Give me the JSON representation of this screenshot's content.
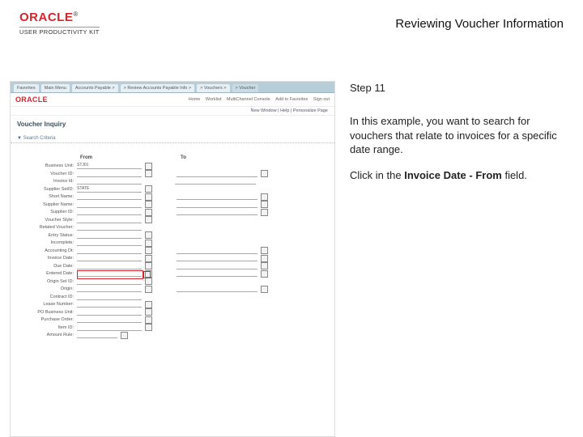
{
  "header": {
    "brand": "ORACLE",
    "tm": "®",
    "sub": "USER PRODUCTIVITY KIT",
    "doc_title": "Reviewing Voucher Information"
  },
  "instructions": {
    "step": "Step 11",
    "para1": "In this example, you want to search for vouchers that relate to invoices for a specific date range.",
    "para2_pre": "Click in the ",
    "para2_bold": "Invoice Date - From",
    "para2_post": " field."
  },
  "screenshot": {
    "tabs": [
      "Favorites",
      "Main Menu",
      "Accounts Payable >",
      "> Review Accounts Payable Info >",
      "> Vouchers >",
      "> Voucher"
    ],
    "logo": "ORACLE",
    "topbar": [
      "Home",
      "Worklist",
      "MultiChannel Console",
      "Add to Favorites",
      "Sign out"
    ],
    "crumb": "New Window | Help | Personalize Page",
    "page_title": "Voucher Inquiry",
    "collapse": "Search Criteria",
    "cols": {
      "from": "From",
      "to": "To"
    },
    "labels": [
      "Business Unit:",
      "Voucher ID:",
      "Invoice Id:",
      "Supplier SetID:",
      "Short Name:",
      "Supplier Name:",
      "Supplier ID:",
      "Voucher Style:",
      "Related Voucher:",
      "Entry Status:",
      "Incomplete:",
      "Accounting Dt:",
      "Invoice Date:",
      "Due Date:",
      "Entered Date:",
      "Origin Set ID:",
      "Origin:",
      "Contract ID:",
      "Lease Number:",
      "PO Business Unit:",
      "Purchase Order:",
      "Item ID:",
      "Amount Rule:"
    ],
    "bu_value": "STJ01",
    "setid_value": "STATE"
  }
}
